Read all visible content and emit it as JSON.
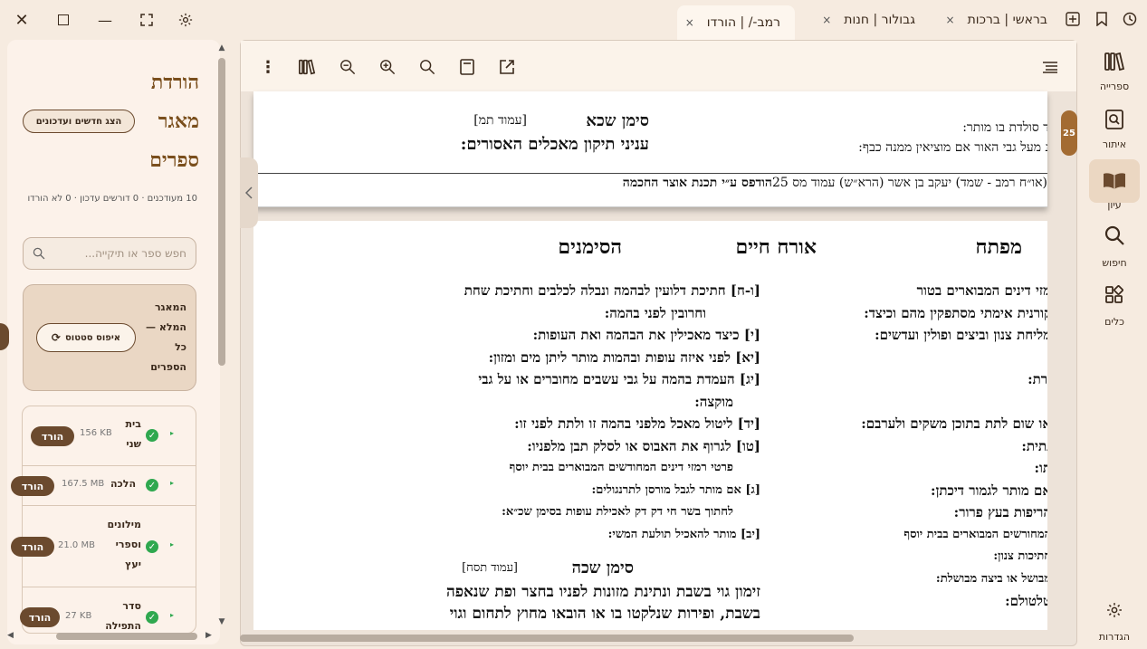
{
  "window": {
    "tabs": [
      {
        "label": "בראשי | ברכות",
        "close": "×"
      },
      {
        "label": "גבולור | חנות",
        "close": "×"
      },
      {
        "label": "רמב-/ | הורדו",
        "close": "×"
      }
    ]
  },
  "nav": {
    "items": [
      {
        "label": "ספרייה",
        "icon": "library-icon"
      },
      {
        "label": "איתור",
        "icon": "locate-icon"
      },
      {
        "label": "עיון",
        "icon": "book-open-icon"
      },
      {
        "label": "חיפוש",
        "icon": "search-icon"
      },
      {
        "label": "כלים",
        "icon": "tools-icon"
      }
    ],
    "settings_label": "הגדרות"
  },
  "viewer": {
    "page_badge": "25",
    "page1": {
      "siman": "סימן שכא",
      "amud": "[עמוד תמ]",
      "subtitle": "עניני תיקון מאכלים האסורים:",
      "right_line1": "ד סולדת בו מותר:",
      "right_line2": "נ מעל גבי האור אם מוציאין ממנה כבף:",
      "top_clip": "",
      "footer_rest": "(או״ח רמב - שמד) יעקב בן אשר (הרא״ש) עמוד מס 25",
      "footer_bold": "הודפס ע״י תכנת אוצר החכמה"
    },
    "page2": {
      "h_right": "מפתח",
      "h_center": "אורח חיים",
      "h_left": "הסימנים",
      "right_col": [
        "מזי דינים המבוארים בטור",
        "קורנית אימתי מסתפקין מהם וכיצד:",
        "מליחת צנון וביצים ופולין ועדשים:",
        "",
        "ורת:",
        "",
        "או שום לתת בתוכן משקים ולערבם:",
        "נתית:",
        "תו:",
        "אם מותר לגמור דיכתן:",
        "הריפות בעץ פרור:",
        "המחורשים המבוארים בבית יוסף",
        "חתיכות צנון:",
        "מבושל או ביצה מבושלת:",
        "טלטולם:"
      ],
      "left_col": [
        "[ו-ח] חתיכת דלועין לבהמה ונבלה לכלבים וחתיכת שחת",
        "וחרובין לפני בהמה:",
        "[י] כיצד מאכילין את הבהמה ואת העופות:",
        "[יא] לפני איזה עופות ובהמות מותר ליתן מים ומזון:",
        "[יג] העמדת בהמה על גבי עשבים מחוברים או על גבי",
        "מוקצה:",
        "[יד] ליטול מאכל מלפני בהמה זו ולתת לפני זו:",
        "[טו] לגרוף את האבוס או לסלק תבן מלפניו:",
        "פרטי רמזי דינים המחודשים המבוארים בבית יוסף",
        "[ג] אם מותר לגבל מורסן לתרנגולים:",
        "לחתוך בשר חי דק דק לאכילת עופות בסימן שכ״א:",
        "[יב] מותר להאכיל תולעת המשי:"
      ],
      "siman2": "סימן שכה",
      "amud2": "[עמוד תסח]",
      "para1": "זימון גוי בשבת ונתינת מזונות לפניו בחצר ופת שנאפה",
      "para2": "בשבת, ופירות שנלקטו בו או הובאו מחוץ לתחום וגוי"
    }
  },
  "leftpanel": {
    "title_lines": [
      "הורדת",
      "מאגר",
      "ספרים"
    ],
    "show_new_label": "הצג חדשים ועדכונים",
    "stats": "10 מעודכנים · 0 דורשים עדכון · 0 לא הורדו",
    "search_placeholder": "חפש ספר או תיקייה...",
    "full_repo_label": "המאגר המלא — כל הספרים",
    "reset_label": "איפוס סטטוס",
    "items": [
      {
        "name": "בית שני",
        "size": "156 KB",
        "action": "הורד"
      },
      {
        "name": "הלכה",
        "size": "167.5 MB",
        "action": "הורד"
      },
      {
        "name": "מילונים וספרי יעץ",
        "size": "21.0 MB",
        "action": "הורד"
      },
      {
        "name": "סדר התפילה",
        "size": "27 KB",
        "action": "הורד"
      }
    ]
  }
}
